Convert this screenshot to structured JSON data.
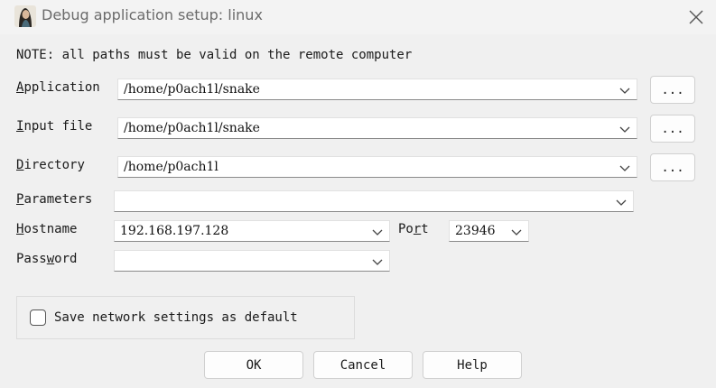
{
  "window": {
    "title": "Debug application setup: linux",
    "icon": "portrait-app-icon",
    "close_icon": "close-icon"
  },
  "note": "NOTE: all paths must be valid on the remote computer",
  "fields": {
    "application": {
      "label_prefix": "A",
      "label_accel": "",
      "label_rest": "pplication",
      "value": "/home/p0ach1l/snake"
    },
    "input_file": {
      "label_prefix": "",
      "label_accel": "I",
      "label_rest": "nput file",
      "value": "/home/p0ach1l/snake"
    },
    "directory": {
      "label_prefix": "",
      "label_accel": "D",
      "label_rest": "irectory",
      "value": "/home/p0ach1l"
    },
    "parameters": {
      "label_prefix": "",
      "label_accel": "P",
      "label_rest": "arameters",
      "value": ""
    },
    "hostname": {
      "label_prefix": "",
      "label_accel": "H",
      "label_rest": "ostname",
      "value": "192.168.197.128"
    },
    "port": {
      "label_prefix": "Po",
      "label_accel": "r",
      "label_rest": "t",
      "value": "23946"
    },
    "password": {
      "label_prefix": "Pass",
      "label_accel": "w",
      "label_rest": "ord",
      "value": ""
    }
  },
  "browse_label": "...",
  "save_network": {
    "label": "Save network settings as default",
    "checked": false
  },
  "buttons": {
    "ok": "OK",
    "cancel": "Cancel",
    "help": "Help"
  }
}
